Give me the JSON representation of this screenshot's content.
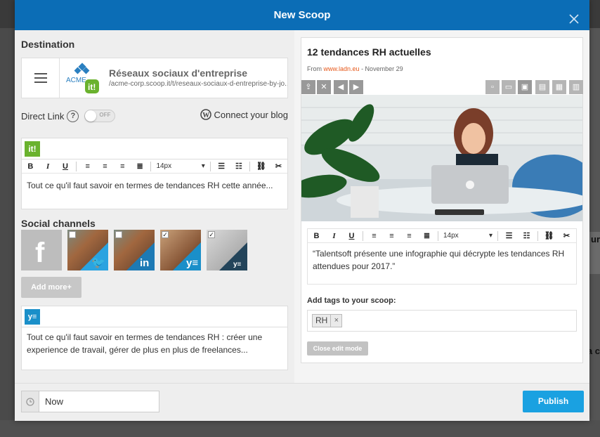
{
  "modal": {
    "title": "New Scoop"
  },
  "destination": {
    "section_title": "Destination",
    "topic_title": "Réseaux sociaux d'entreprise",
    "topic_url": "/acme-corp.scoop.it/t/reseaux-sociaux-d-entreprise-by-jo...",
    "logo_text": "ACME"
  },
  "direct_link": {
    "label": "Direct Link",
    "help": "?",
    "toggle_state": "OFF"
  },
  "connect_blog": {
    "label": "Connect your blog"
  },
  "main_editor": {
    "badge": "it!",
    "font_size": "14px",
    "text": "Tout ce qu'il faut savoir en termes de tendances RH cette année..."
  },
  "toolbar": {
    "bold": "B",
    "italic": "I",
    "underline": "U"
  },
  "social": {
    "section_title": "Social channels",
    "channels": [
      {
        "name": "facebook",
        "checked": false
      },
      {
        "name": "twitter",
        "checked": false
      },
      {
        "name": "linkedin",
        "checked": false
      },
      {
        "name": "yammer",
        "checked": true
      },
      {
        "name": "yammer-group",
        "checked": true
      }
    ],
    "add_more_label": "Add more+"
  },
  "yammer_editor": {
    "badge": "y≡",
    "text": "Tout ce qu'il faut savoir en termes de tendances RH : créer une experience de travail, gérer de plus en plus de freelances..."
  },
  "schedule": {
    "value": "Now"
  },
  "publish_label": "Publish",
  "article": {
    "title": "12 tendances RH actuelles",
    "from_label": "From",
    "source": "www.ladn.eu",
    "date": "- November 29",
    "quote_font_size": "14px",
    "quote": "“Talentsoft présente une infographie qui décrypte les tendances RH attendues pour 2017.”"
  },
  "tags": {
    "title": "Add tags to your scoop:",
    "items": [
      "RH"
    ],
    "remove_glyph": "×"
  },
  "close_edit_label": "Close edit mode",
  "background": {
    "right_text_1": "ur",
    "right_text_2": "a c"
  },
  "colors": {
    "header_blue": "#0b6db6",
    "publish_blue": "#1aa1e1",
    "scoop_green": "#6ab22e",
    "source_orange": "#e6581a"
  }
}
